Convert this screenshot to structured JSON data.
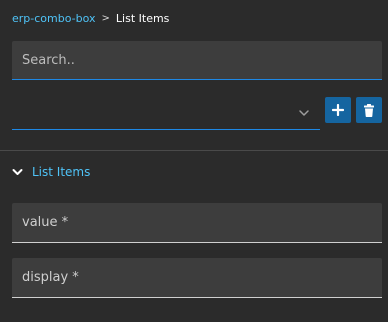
{
  "breadcrumb": {
    "parent": "erp-combo-box",
    "separator": ">",
    "current": "List Items"
  },
  "search": {
    "placeholder": "Search.."
  },
  "combo": {
    "selected_value": ""
  },
  "actions": {
    "add_icon": "plus-icon",
    "delete_icon": "trash-icon"
  },
  "section": {
    "title": "List Items"
  },
  "fields": {
    "value_placeholder": "value *",
    "display_placeholder": "display *"
  },
  "colors": {
    "background": "#2b2b2b",
    "field_background": "#3d3d3d",
    "accent_link": "#4fc3f7",
    "accent_underline": "#1e88e5",
    "button_background": "#1565a0"
  }
}
